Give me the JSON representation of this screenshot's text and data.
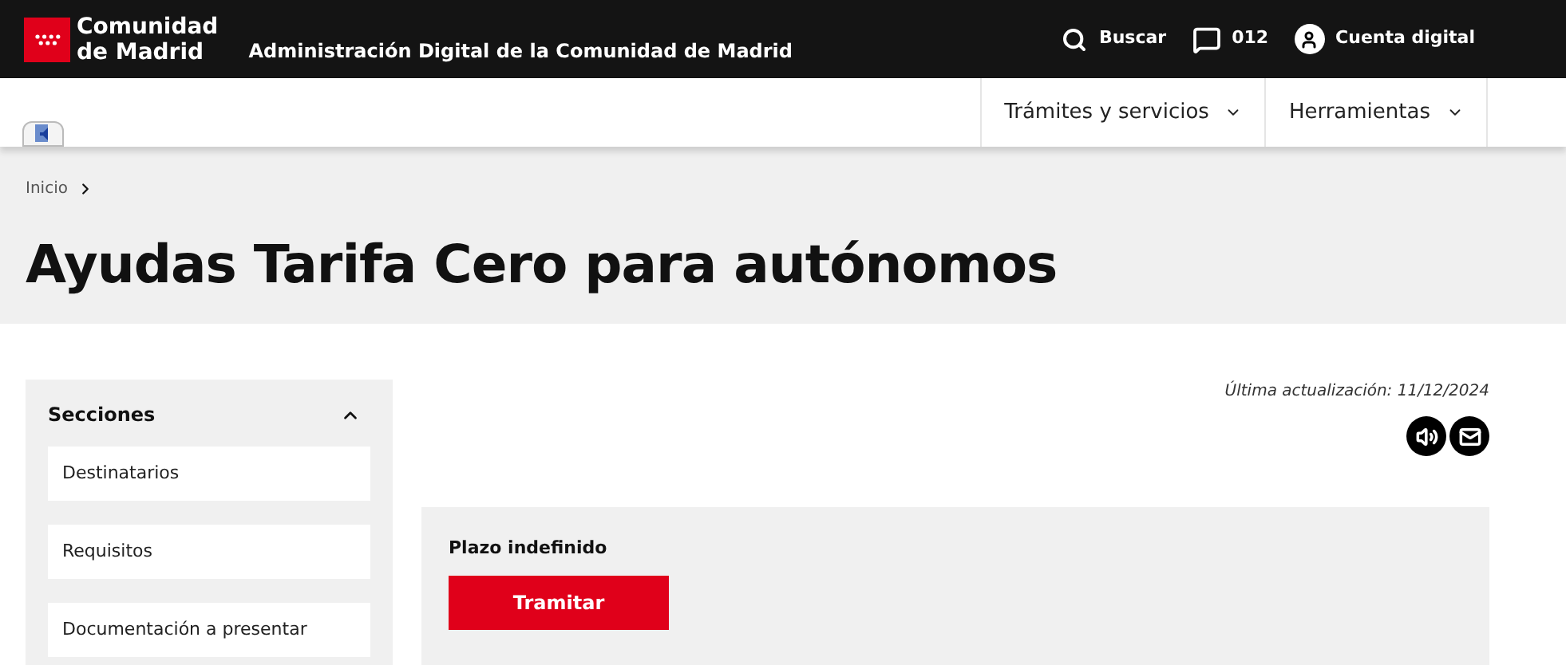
{
  "header": {
    "logo_line_1": "Comunidad",
    "logo_line_2": "de Madrid",
    "site_title": "Administración Digital de la Comunidad de Madrid",
    "actions": [
      {
        "kind": "search",
        "label": "Buscar"
      },
      {
        "kind": "chat",
        "label": "012"
      },
      {
        "kind": "account",
        "label": "Cuenta digital"
      }
    ]
  },
  "nav": [
    {
      "label": "Trámites y servicios"
    },
    {
      "label": "Herramientas"
    }
  ],
  "breadcrumb": [
    {
      "label": "Inicio"
    }
  ],
  "title": "Ayudas Tarifa Cero para autónomos",
  "sidebar": {
    "title": "Secciones",
    "expanded": true,
    "items": [
      {
        "label": "Destinatarios"
      },
      {
        "label": "Requisitos"
      },
      {
        "label": "Documentación a presentar"
      }
    ]
  },
  "last_update": "Última actualización: 11/12/2024",
  "box": {
    "label": "Plazo indefinido",
    "button": "Tramitar"
  }
}
